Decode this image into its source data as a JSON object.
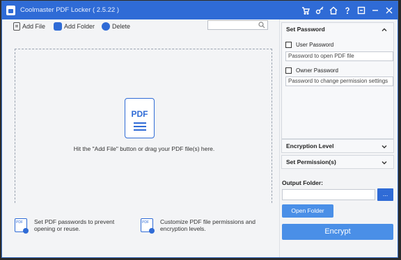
{
  "window": {
    "title": "Coolmaster PDF Locker   ( 2.5.22 )"
  },
  "titlebar_icons": [
    "cart-icon",
    "key-icon",
    "home-icon",
    "help-icon",
    "feedback-icon",
    "minimize-icon",
    "close-icon"
  ],
  "toolbar": {
    "add_file": "Add File",
    "add_folder": "Add Folder",
    "delete": "Delete"
  },
  "search": {
    "value": "",
    "placeholder": ""
  },
  "drop_area": {
    "icon_label": "PDF",
    "hint": "Hit the \"Add File\" button or drag your PDF file(s) here."
  },
  "tips": [
    {
      "icon_label": "PDF",
      "text": "Set PDF passwords to prevent opening or reuse."
    },
    {
      "icon_label": "PDF",
      "text": "Customize PDF file permissions and encryption levels."
    }
  ],
  "panel": {
    "set_password": "Set Password",
    "user_password_label": "User Password",
    "user_password_placeholder": "Password to open PDF file",
    "owner_password_label": "Owner Password",
    "owner_password_placeholder": "Password to change permission settings",
    "encryption_level": "Encryption Level",
    "set_permissions": "Set Permission(s)",
    "output_folder_label": "Output Folder:",
    "output_folder_value": "",
    "browse": "...",
    "open_folder": "Open Folder",
    "encrypt": "Encrypt"
  },
  "colors": {
    "accent": "#2f6bd6",
    "button": "#4a8fe7"
  }
}
